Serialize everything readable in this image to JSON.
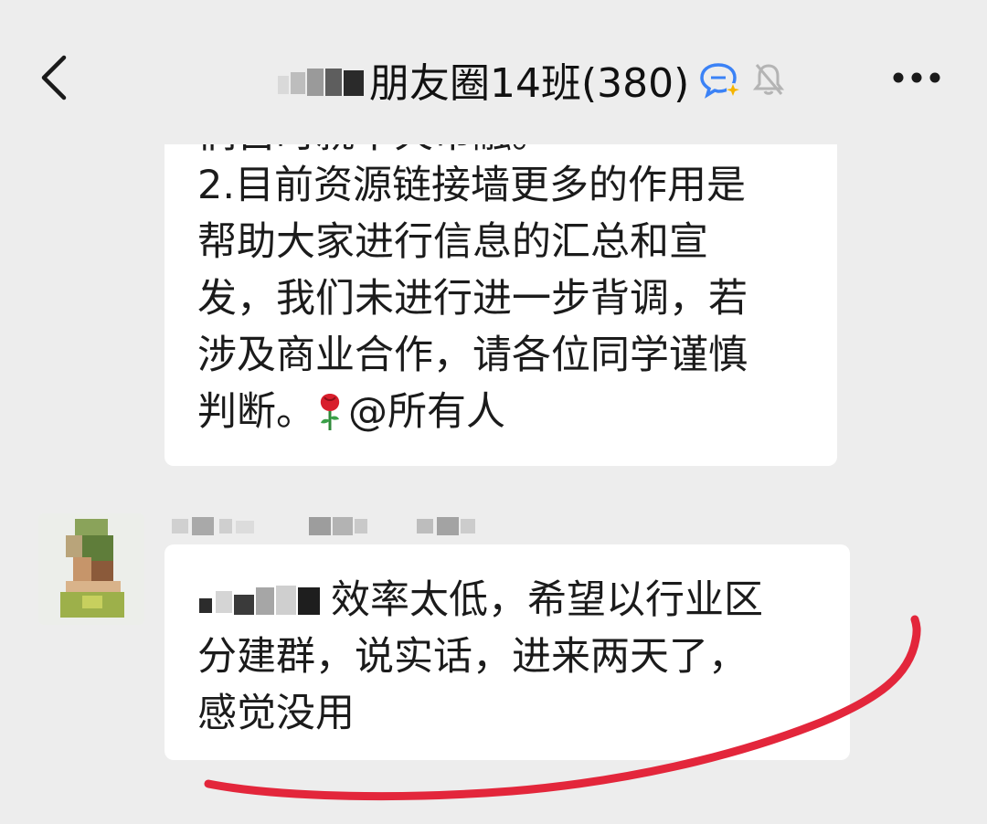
{
  "header": {
    "title": "朋友圈14班(380)",
    "back_icon": "chevron-left-icon",
    "chat_icon": "chat-bubble-icon",
    "mute_icon": "bell-muted-icon",
    "more_icon": "more-horizontal-icon"
  },
  "messages": [
    {
      "cut_line": "们自时就十火市融。",
      "lines": [
        "2.目前资源链接墙更多的作用是",
        "帮助大家进行信息的汇总和宣",
        "发，我们未进行进一步背调，若",
        "涉及商业合作，请各位同学谨慎"
      ],
      "last_line_prefix": "判断。",
      "emoji_icon": "rose-icon",
      "mention": "@所有人"
    },
    {
      "line1_suffix": "效率太低，希望以行业区",
      "line2": "分建群，说实话，进来两天了，",
      "line3": "感觉没用"
    }
  ],
  "colors": {
    "background": "#ededed",
    "bubble": "#ffffff",
    "annotation": "#e3263b",
    "chat_icon": "#3b82f6"
  }
}
